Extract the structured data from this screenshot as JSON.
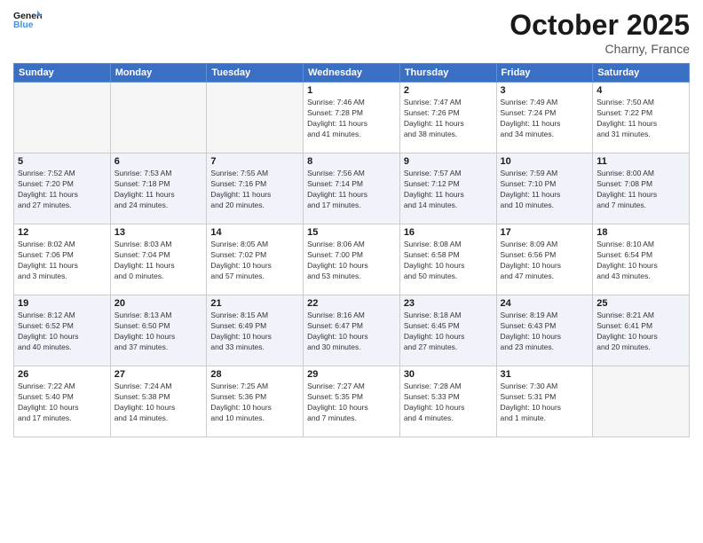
{
  "header": {
    "logo_general": "General",
    "logo_blue": "Blue",
    "month": "October 2025",
    "location": "Charny, France"
  },
  "weekdays": [
    "Sunday",
    "Monday",
    "Tuesday",
    "Wednesday",
    "Thursday",
    "Friday",
    "Saturday"
  ],
  "weeks": [
    [
      {
        "day": "",
        "info": ""
      },
      {
        "day": "",
        "info": ""
      },
      {
        "day": "",
        "info": ""
      },
      {
        "day": "1",
        "info": "Sunrise: 7:46 AM\nSunset: 7:28 PM\nDaylight: 11 hours\nand 41 minutes."
      },
      {
        "day": "2",
        "info": "Sunrise: 7:47 AM\nSunset: 7:26 PM\nDaylight: 11 hours\nand 38 minutes."
      },
      {
        "day": "3",
        "info": "Sunrise: 7:49 AM\nSunset: 7:24 PM\nDaylight: 11 hours\nand 34 minutes."
      },
      {
        "day": "4",
        "info": "Sunrise: 7:50 AM\nSunset: 7:22 PM\nDaylight: 11 hours\nand 31 minutes."
      }
    ],
    [
      {
        "day": "5",
        "info": "Sunrise: 7:52 AM\nSunset: 7:20 PM\nDaylight: 11 hours\nand 27 minutes."
      },
      {
        "day": "6",
        "info": "Sunrise: 7:53 AM\nSunset: 7:18 PM\nDaylight: 11 hours\nand 24 minutes."
      },
      {
        "day": "7",
        "info": "Sunrise: 7:55 AM\nSunset: 7:16 PM\nDaylight: 11 hours\nand 20 minutes."
      },
      {
        "day": "8",
        "info": "Sunrise: 7:56 AM\nSunset: 7:14 PM\nDaylight: 11 hours\nand 17 minutes."
      },
      {
        "day": "9",
        "info": "Sunrise: 7:57 AM\nSunset: 7:12 PM\nDaylight: 11 hours\nand 14 minutes."
      },
      {
        "day": "10",
        "info": "Sunrise: 7:59 AM\nSunset: 7:10 PM\nDaylight: 11 hours\nand 10 minutes."
      },
      {
        "day": "11",
        "info": "Sunrise: 8:00 AM\nSunset: 7:08 PM\nDaylight: 11 hours\nand 7 minutes."
      }
    ],
    [
      {
        "day": "12",
        "info": "Sunrise: 8:02 AM\nSunset: 7:06 PM\nDaylight: 11 hours\nand 3 minutes."
      },
      {
        "day": "13",
        "info": "Sunrise: 8:03 AM\nSunset: 7:04 PM\nDaylight: 11 hours\nand 0 minutes."
      },
      {
        "day": "14",
        "info": "Sunrise: 8:05 AM\nSunset: 7:02 PM\nDaylight: 10 hours\nand 57 minutes."
      },
      {
        "day": "15",
        "info": "Sunrise: 8:06 AM\nSunset: 7:00 PM\nDaylight: 10 hours\nand 53 minutes."
      },
      {
        "day": "16",
        "info": "Sunrise: 8:08 AM\nSunset: 6:58 PM\nDaylight: 10 hours\nand 50 minutes."
      },
      {
        "day": "17",
        "info": "Sunrise: 8:09 AM\nSunset: 6:56 PM\nDaylight: 10 hours\nand 47 minutes."
      },
      {
        "day": "18",
        "info": "Sunrise: 8:10 AM\nSunset: 6:54 PM\nDaylight: 10 hours\nand 43 minutes."
      }
    ],
    [
      {
        "day": "19",
        "info": "Sunrise: 8:12 AM\nSunset: 6:52 PM\nDaylight: 10 hours\nand 40 minutes."
      },
      {
        "day": "20",
        "info": "Sunrise: 8:13 AM\nSunset: 6:50 PM\nDaylight: 10 hours\nand 37 minutes."
      },
      {
        "day": "21",
        "info": "Sunrise: 8:15 AM\nSunset: 6:49 PM\nDaylight: 10 hours\nand 33 minutes."
      },
      {
        "day": "22",
        "info": "Sunrise: 8:16 AM\nSunset: 6:47 PM\nDaylight: 10 hours\nand 30 minutes."
      },
      {
        "day": "23",
        "info": "Sunrise: 8:18 AM\nSunset: 6:45 PM\nDaylight: 10 hours\nand 27 minutes."
      },
      {
        "day": "24",
        "info": "Sunrise: 8:19 AM\nSunset: 6:43 PM\nDaylight: 10 hours\nand 23 minutes."
      },
      {
        "day": "25",
        "info": "Sunrise: 8:21 AM\nSunset: 6:41 PM\nDaylight: 10 hours\nand 20 minutes."
      }
    ],
    [
      {
        "day": "26",
        "info": "Sunrise: 7:22 AM\nSunset: 5:40 PM\nDaylight: 10 hours\nand 17 minutes."
      },
      {
        "day": "27",
        "info": "Sunrise: 7:24 AM\nSunset: 5:38 PM\nDaylight: 10 hours\nand 14 minutes."
      },
      {
        "day": "28",
        "info": "Sunrise: 7:25 AM\nSunset: 5:36 PM\nDaylight: 10 hours\nand 10 minutes."
      },
      {
        "day": "29",
        "info": "Sunrise: 7:27 AM\nSunset: 5:35 PM\nDaylight: 10 hours\nand 7 minutes."
      },
      {
        "day": "30",
        "info": "Sunrise: 7:28 AM\nSunset: 5:33 PM\nDaylight: 10 hours\nand 4 minutes."
      },
      {
        "day": "31",
        "info": "Sunrise: 7:30 AM\nSunset: 5:31 PM\nDaylight: 10 hours\nand 1 minute."
      },
      {
        "day": "",
        "info": ""
      }
    ]
  ]
}
